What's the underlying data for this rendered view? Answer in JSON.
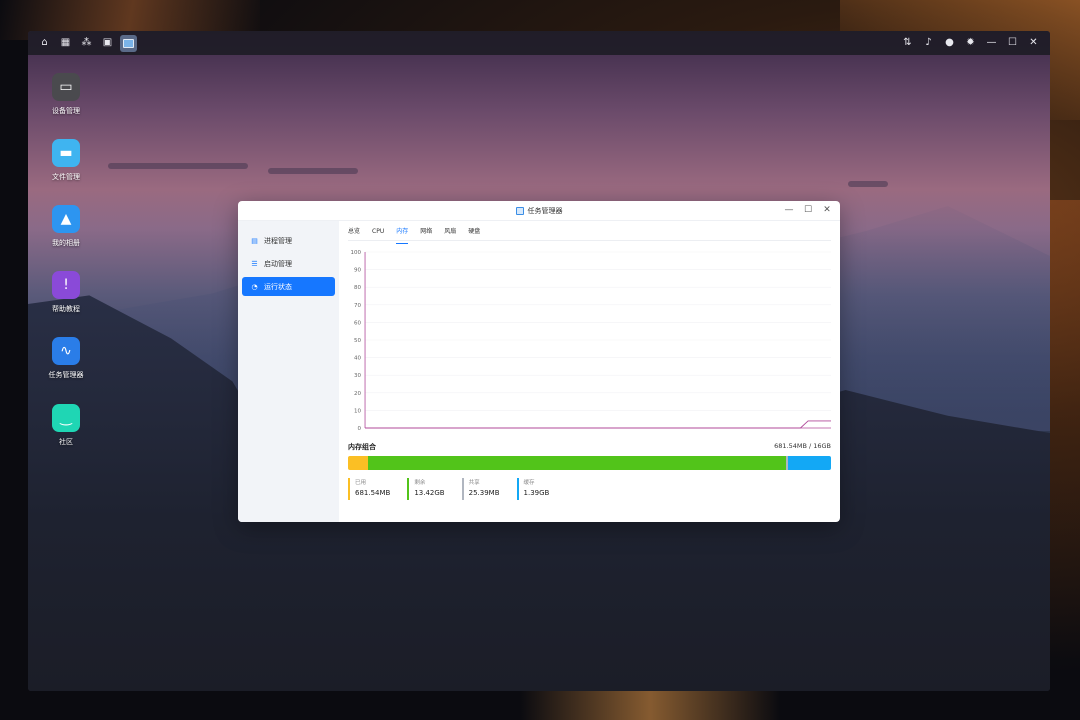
{
  "taskbar": {
    "left_icons": [
      "home-icon",
      "apps-grid-icon",
      "network-icon",
      "device-icon",
      "task-manager-thumb-icon"
    ],
    "right_icons": [
      "transfer-icon",
      "bell-icon",
      "user-icon",
      "settings-icon"
    ],
    "window_controls": {
      "minimize": "—",
      "maximize": "☐",
      "close": "✕"
    }
  },
  "desktop": {
    "icons": [
      {
        "label": "设备管理",
        "icon": "device-manager-icon",
        "color": "#4a4a4e"
      },
      {
        "label": "文件管理",
        "icon": "folder-icon",
        "color": "#3fb4f0"
      },
      {
        "label": "我的相册",
        "icon": "photo-icon",
        "color": "#2d95f0"
      },
      {
        "label": "帮助教程",
        "icon": "help-icon",
        "color": "#8a4ad8"
      },
      {
        "label": "任务管理器",
        "icon": "task-manager-icon",
        "color": "#2a7de8"
      },
      {
        "label": "社区",
        "icon": "community-icon",
        "color": "#1fd6b4"
      }
    ]
  },
  "window": {
    "title": "任务管理器",
    "controls": {
      "minimize": "—",
      "maximize": "☐",
      "close": "✕"
    },
    "sidebar": {
      "items": [
        {
          "label": "进程管理",
          "icon": "process-icon",
          "active": false
        },
        {
          "label": "启动管理",
          "icon": "startup-icon",
          "active": false
        },
        {
          "label": "运行状态",
          "icon": "status-icon",
          "active": true
        }
      ]
    },
    "tabs": [
      {
        "label": "总览",
        "active": false
      },
      {
        "label": "CPU",
        "active": false
      },
      {
        "label": "内存",
        "active": true
      },
      {
        "label": "网络",
        "active": false
      },
      {
        "label": "风扇",
        "active": false
      },
      {
        "label": "硬盘",
        "active": false
      }
    ],
    "chart_data": {
      "type": "line",
      "y_ticks": [
        "100",
        "90",
        "80",
        "70",
        "60",
        "50",
        "40",
        "30",
        "20",
        "10",
        "0"
      ],
      "ylim": [
        0,
        100
      ],
      "series": [
        {
          "values": [
            0,
            0,
            0,
            0,
            0,
            0,
            0,
            0,
            0,
            0,
            0,
            0,
            0,
            0,
            0,
            0,
            0,
            0,
            0,
            0,
            0,
            0,
            0,
            0,
            0,
            0,
            0,
            0,
            0,
            0,
            0,
            0,
            0,
            0,
            0,
            0,
            0,
            0,
            0,
            0,
            0,
            0,
            0,
            0,
            0,
            0,
            0,
            0,
            0,
            0,
            0,
            0,
            0,
            0,
            0,
            0,
            0,
            0,
            4,
            4,
            4,
            4
          ],
          "color": "#b04a9a"
        }
      ],
      "grid": true
    },
    "memory": {
      "title": "内存组合",
      "total": "681.54MB / 16GB",
      "segments": [
        {
          "name": "已用",
          "value": "681.54MB",
          "fraction": 0.042,
          "color": "#fbbf24"
        },
        {
          "name": "剩余",
          "value": "13.42GB",
          "fraction": 0.865,
          "color": "#52c41a"
        },
        {
          "name": "共享",
          "value": "25.39MB",
          "fraction": 0.003,
          "color": "#b0b6c0"
        },
        {
          "name": "缓存",
          "value": "1.39GB",
          "fraction": 0.09,
          "color": "#13a8f5"
        }
      ]
    }
  }
}
